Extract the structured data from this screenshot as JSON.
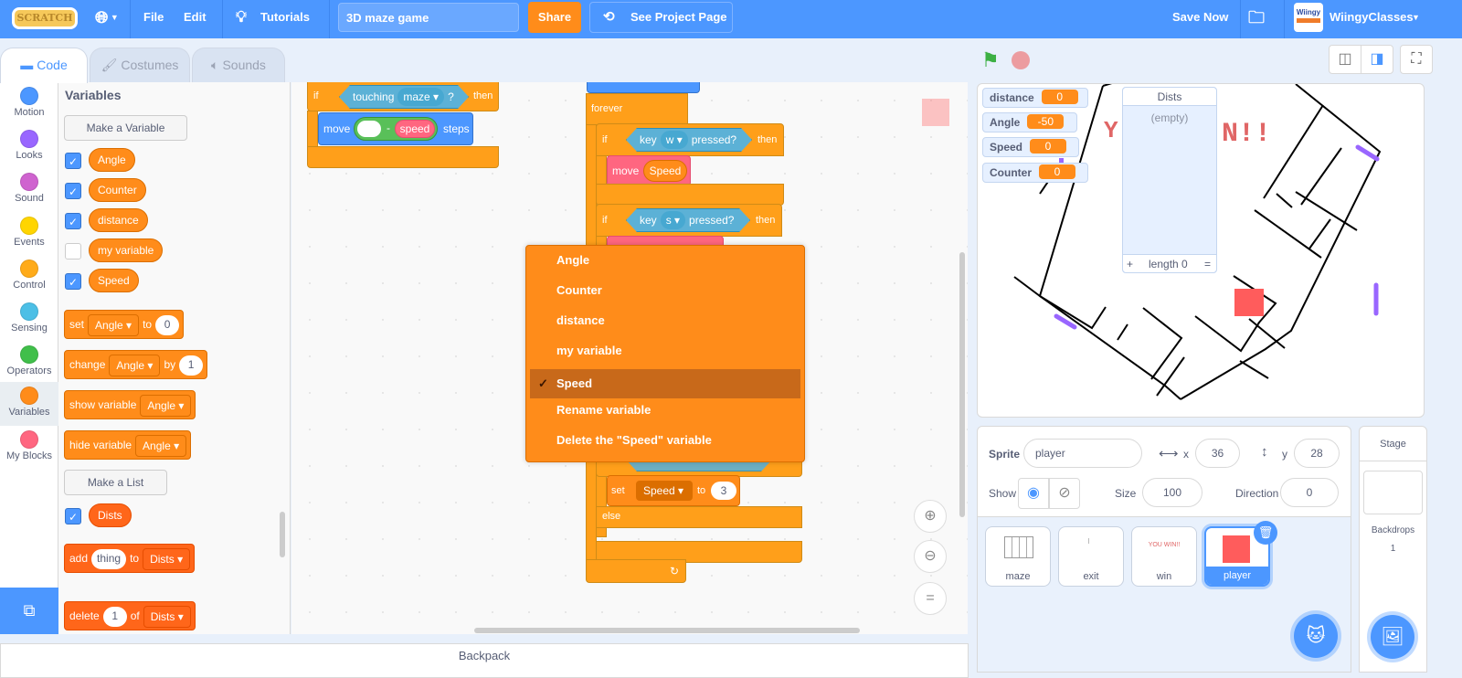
{
  "menubar": {
    "logo": "SCRATCH",
    "file": "File",
    "edit": "Edit",
    "tutorials": "Tutorials",
    "project_title": "3D maze game",
    "share": "Share",
    "see_project_page": "See Project Page",
    "save_now": "Save Now",
    "username": "WiingyClasses",
    "avatar_text": "Wiingy"
  },
  "tabs": [
    {
      "label": "Code"
    },
    {
      "label": "Costumes"
    },
    {
      "label": "Sounds"
    }
  ],
  "categories": [
    {
      "label": "Motion",
      "color": "#4c97ff"
    },
    {
      "label": "Looks",
      "color": "#9966ff"
    },
    {
      "label": "Sound",
      "color": "#cf63cf"
    },
    {
      "label": "Events",
      "color": "#ffd500"
    },
    {
      "label": "Control",
      "color": "#ffab19"
    },
    {
      "label": "Sensing",
      "color": "#4cbfe6"
    },
    {
      "label": "Operators",
      "color": "#40bf4a"
    },
    {
      "label": "Variables",
      "color": "#ff8c1a"
    },
    {
      "label": "My Blocks",
      "color": "#ff6680"
    }
  ],
  "palette": {
    "heading": "Variables",
    "make_variable": "Make a Variable",
    "variables": [
      {
        "name": "Angle",
        "checked": true
      },
      {
        "name": "Counter",
        "checked": true
      },
      {
        "name": "distance",
        "checked": true
      },
      {
        "name": "my variable",
        "checked": false
      },
      {
        "name": "Speed",
        "checked": true
      }
    ],
    "set_block": {
      "word": "set",
      "var": "Angle",
      "to": "to",
      "value": "0"
    },
    "change_block": {
      "word": "change",
      "var": "Angle",
      "by": "by",
      "value": "1"
    },
    "show_block": {
      "word": "show variable",
      "var": "Angle"
    },
    "hide_block": {
      "word": "hide variable",
      "var": "Angle"
    },
    "make_list": "Make a List",
    "list": {
      "name": "Dists",
      "checked": true
    },
    "add_block": {
      "word": "add",
      "value": "thing",
      "to": "to",
      "list": "Dists"
    },
    "delete_block": {
      "word": "delete",
      "value": "1",
      "of": "of",
      "list": "Dists"
    }
  },
  "workspace": {
    "script1": {
      "if": "if",
      "touching": "touching",
      "touching_target": "maze",
      "q": "?",
      "then": "then",
      "move": "move",
      "minus": "-",
      "speed": "speed",
      "steps": "steps"
    },
    "script2": {
      "forever": "forever",
      "if1": "if",
      "key1": "key",
      "key1_val": "w",
      "pressed1": "pressed?",
      "then1": "then",
      "move": "move",
      "move_var": "Speed",
      "if2": "if",
      "key2": "key",
      "key2_val": "s",
      "pressed2": "pressed?",
      "then2": "then",
      "set": "set",
      "set_var": "Speed",
      "to": "to",
      "set_val": "3",
      "else": "else"
    }
  },
  "dropdown_menu": {
    "items": [
      {
        "label": "Angle",
        "selected": false
      },
      {
        "label": "Counter",
        "selected": false
      },
      {
        "label": "distance",
        "selected": false
      },
      {
        "label": "my variable",
        "selected": false
      },
      {
        "label": "Speed",
        "selected": true
      },
      {
        "label": "Rename variable",
        "selected": false
      },
      {
        "label": "Delete the \"Speed\" variable",
        "selected": false
      }
    ],
    "check": "✓"
  },
  "stage": {
    "monitors": [
      {
        "label": "distance",
        "value": "0"
      },
      {
        "label": "Angle",
        "value": "-50"
      },
      {
        "label": "Speed",
        "value": "0"
      },
      {
        "label": "Counter",
        "value": "0"
      }
    ],
    "list_monitor": {
      "title": "Dists",
      "empty": "(empty)",
      "add": "+",
      "length": "length 0",
      "resize": "="
    }
  },
  "sprite_info": {
    "sprite_label": "Sprite",
    "sprite_name": "player",
    "x_label": "x",
    "x": "36",
    "y_label": "y",
    "y": "28",
    "show_label": "Show",
    "size_label": "Size",
    "size": "100",
    "direction_label": "Direction",
    "direction": "0"
  },
  "sprites": [
    {
      "name": "maze",
      "selected": false
    },
    {
      "name": "exit",
      "selected": false
    },
    {
      "name": "win",
      "selected": false,
      "thumb_text": "YOU WIN!!"
    },
    {
      "name": "player",
      "selected": true
    }
  ],
  "stage_panel": {
    "title": "Stage",
    "backdrops_label": "Backdrops",
    "backdrops_count": "1"
  },
  "backpack": "Backpack"
}
